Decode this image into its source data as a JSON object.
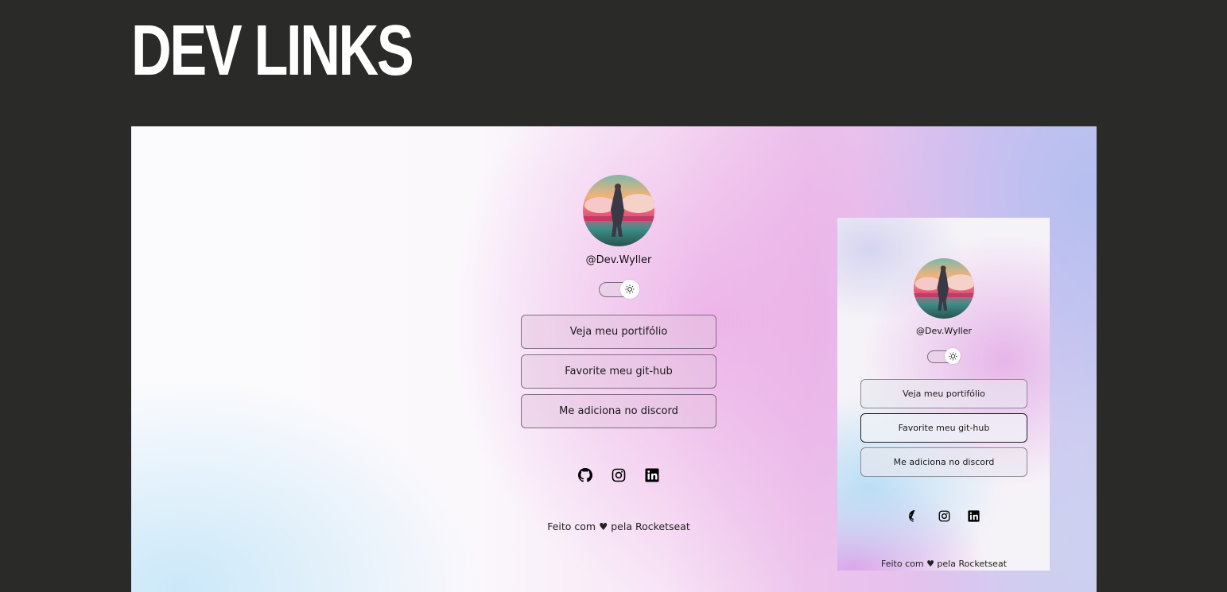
{
  "page": {
    "title": "DEV LINKS"
  },
  "profile": {
    "handle": "@Dev.Wyller"
  },
  "links": [
    {
      "label": "Veja meu portifólio"
    },
    {
      "label": "Favorite meu git-hub"
    },
    {
      "label": "Me adiciona no discord"
    }
  ],
  "socials": [
    {
      "icon": "github-icon"
    },
    {
      "icon": "instagram-icon"
    },
    {
      "icon": "linkedin-icon"
    }
  ],
  "footer": {
    "text": "Feito com ♥ pela Rocketseat"
  },
  "theme_toggle": {
    "icon": "sun-icon",
    "state": "light"
  }
}
